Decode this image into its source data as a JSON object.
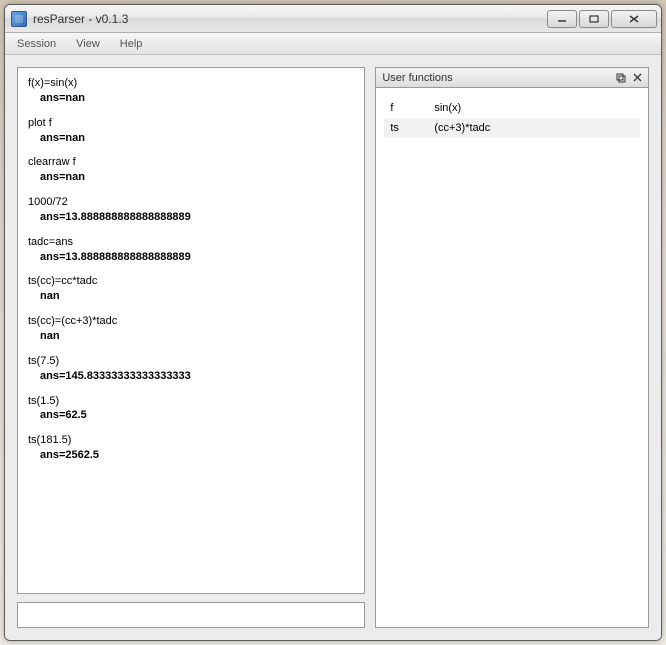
{
  "window": {
    "title": "resParser - v0.1.3"
  },
  "menubar": {
    "items": [
      {
        "label": "Session"
      },
      {
        "label": "View"
      },
      {
        "label": "Help"
      }
    ]
  },
  "console": {
    "entries": [
      {
        "cmd": "f(x)=sin(x)",
        "ans": "ans=nan"
      },
      {
        "cmd": "plot f",
        "ans": "ans=nan"
      },
      {
        "cmd": "clearraw f",
        "ans": "ans=nan"
      },
      {
        "cmd": "1000/72",
        "ans": "ans=13.888888888888888889"
      },
      {
        "cmd": "tadc=ans",
        "ans": "ans=13.888888888888888889"
      },
      {
        "cmd": "ts(cc)=cc*tadc",
        "ans": "nan"
      },
      {
        "cmd": "ts(cc)=(cc+3)*tadc",
        "ans": "nan"
      },
      {
        "cmd": "ts(7.5)",
        "ans": "ans=145.83333333333333333"
      },
      {
        "cmd": "ts(1.5)",
        "ans": "ans=62.5"
      },
      {
        "cmd": "ts(181.5)",
        "ans": "ans=2562.5"
      }
    ]
  },
  "input": {
    "value": "",
    "placeholder": ""
  },
  "user_functions": {
    "title": "User functions",
    "items": [
      {
        "name": "f",
        "body": "sin(x)"
      },
      {
        "name": "ts",
        "body": "(cc+3)*tadc"
      }
    ]
  }
}
